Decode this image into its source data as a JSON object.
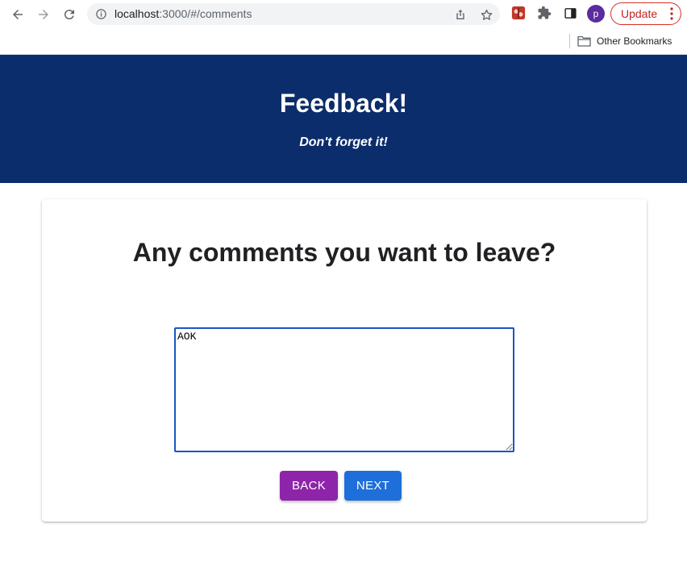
{
  "browser": {
    "url_host": "localhost",
    "url_path": ":3000/#/comments",
    "update_label": "Update",
    "avatar_letter": "p",
    "bookmarks": {
      "other_label": "Other Bookmarks"
    },
    "icons": [
      "back-arrow-icon",
      "forward-arrow-icon",
      "reload-icon",
      "info-icon",
      "share-icon",
      "star-icon",
      "extension-icon",
      "puzzle-icon",
      "side-panel-icon",
      "folder-icon",
      "more-vert-icon"
    ]
  },
  "header": {
    "title": "Feedback!",
    "subtitle": "Don't forget it!",
    "background": "#0b2d6b"
  },
  "card": {
    "question": "Any comments you want to leave?",
    "comment_value": "AOK",
    "back_label": "BACK",
    "next_label": "NEXT",
    "back_color": "#8e24aa",
    "next_color": "#1e6fd9"
  }
}
